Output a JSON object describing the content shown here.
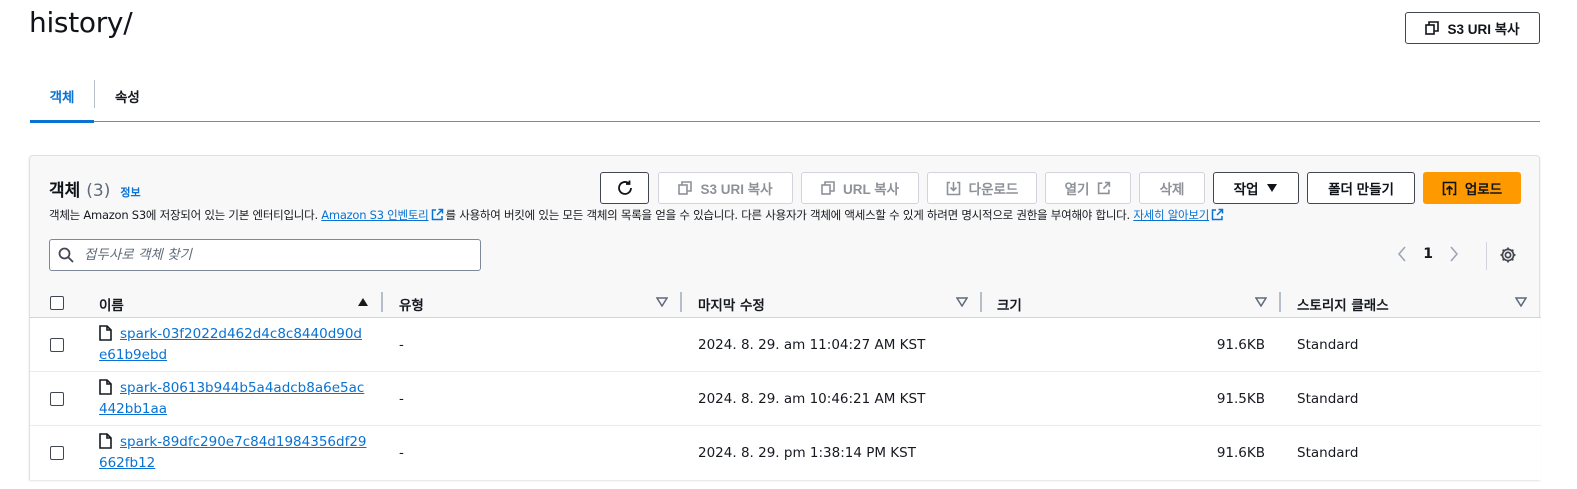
{
  "header": {
    "title": "history/",
    "copy_uri_label": "S3 URI 복사"
  },
  "tabs": [
    {
      "label": "객체",
      "active": true
    },
    {
      "label": "속성",
      "active": false
    }
  ],
  "objects_panel": {
    "title": "객체",
    "count": "(3)",
    "info": "정보",
    "description": {
      "part1": "객체는 Amazon S3에 저장되어 있는 기본 엔터티입니다.",
      "link1": "Amazon S3 인벤토리",
      "part2": "를 사용하여 버킷에 있는 모든 객체의 목록을 얻을 수 있습니다. 다른 사용자가 객체에 액세스할 수 있게 하려면 명시적으로 권한을 부여해야 합니다.",
      "link2": "자세히 알아보기"
    },
    "toolbar": {
      "copy_uri": "S3 URI 복사",
      "copy_url": "URL 복사",
      "download": "다운로드",
      "open": "열기",
      "delete": "삭제",
      "actions": "작업",
      "create_folder": "폴더 만들기",
      "upload": "업로드"
    },
    "search": {
      "placeholder": "접두사로 객체 찾기"
    },
    "pagination": {
      "current_page": "1"
    },
    "columns": {
      "name": "이름",
      "type": "유형",
      "last_modified": "마지막 수정",
      "size": "크기",
      "storage_class": "스토리지 클래스"
    },
    "rows": [
      {
        "name": "spark-03f2022d462d4c8c8440d90de61b9ebd",
        "type": "-",
        "last_modified": "2024. 8. 29. am 11:04:27 AM KST",
        "size": "91.6KB",
        "storage_class": "Standard"
      },
      {
        "name": "spark-80613b944b5a4adcb8a6e5ac442bb1aa",
        "type": "-",
        "last_modified": "2024. 8. 29. am 10:46:21 AM KST",
        "size": "91.5KB",
        "storage_class": "Standard"
      },
      {
        "name": "spark-89dfc290e7c84d1984356df29662fb12",
        "type": "-",
        "last_modified": "2024. 8. 29. pm 1:38:14 PM KST",
        "size": "91.6KB",
        "storage_class": "Standard"
      }
    ]
  },
  "colors": {
    "accent": "#0972d3",
    "primary_button": "#ff9900",
    "text": "#16191f"
  },
  "icons": [
    "copy-icon",
    "refresh-icon",
    "download-icon",
    "external-link-icon",
    "caret-down-icon",
    "upload-icon",
    "search-icon",
    "chevron-left-icon",
    "chevron-right-icon",
    "gear-icon",
    "file-icon",
    "sort-up-icon",
    "sort-down-icon"
  ]
}
